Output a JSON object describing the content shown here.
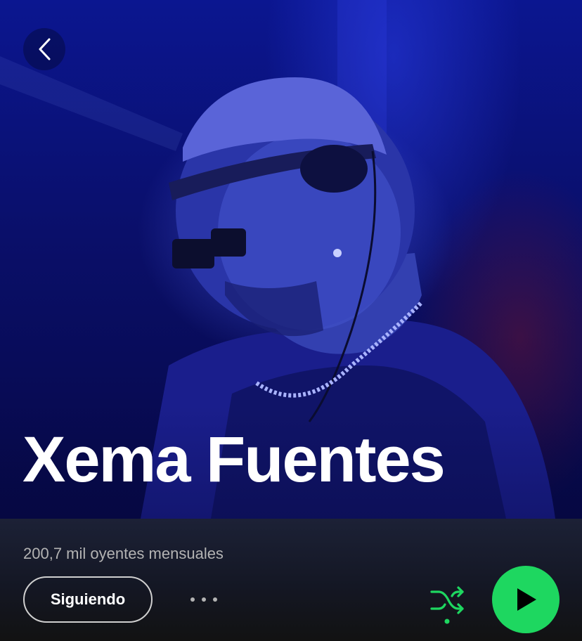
{
  "artist": {
    "name": "Xema Fuentes",
    "monthly_listeners": "200,7 mil oyentes mensuales"
  },
  "actions": {
    "follow_label": "Siguiendo"
  },
  "icons": {
    "back": "chevron-left-icon",
    "more": "more-horizontal-icon",
    "shuffle": "shuffle-icon",
    "play": "play-icon"
  },
  "colors": {
    "accent_green": "#1ed760",
    "hero_blue": "#0b1690",
    "background": "#121212",
    "secondary_text": "#b3b3b3"
  }
}
